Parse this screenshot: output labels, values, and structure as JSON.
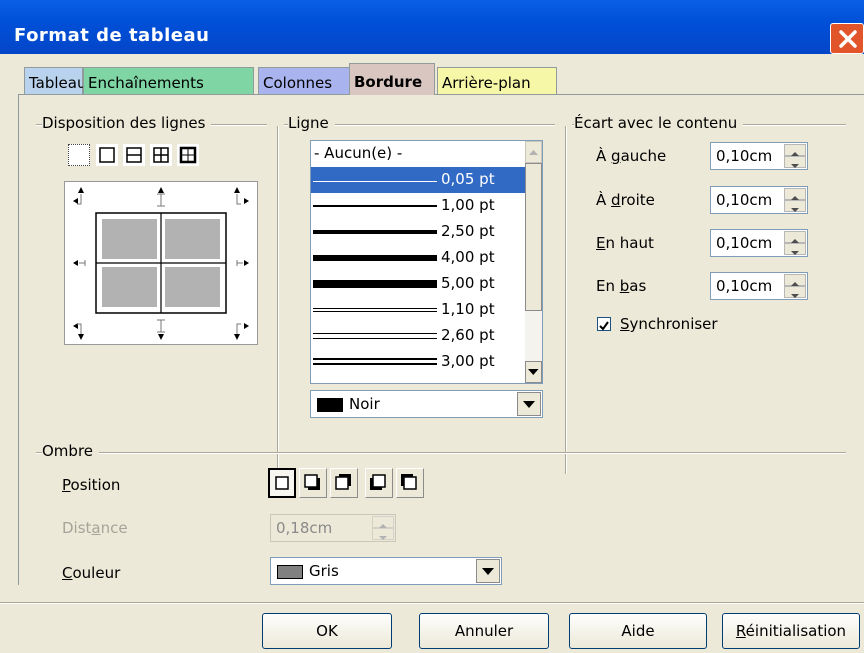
{
  "window": {
    "title": "Format de tableau"
  },
  "tabs": [
    {
      "label": "Tableau",
      "bg": "#b9d3ee",
      "active": false
    },
    {
      "label": "Enchaînements",
      "bg": "#7fd6a4",
      "active": false
    },
    {
      "label": "Colonnes",
      "bg": "#a9b3ee",
      "active": false
    },
    {
      "label": "Bordure",
      "bg": "#d9c6c0",
      "active": true
    },
    {
      "label": "Arrière-plan",
      "bg": "#f7f7a8",
      "active": false
    }
  ],
  "disposition": {
    "title": "Disposition des lignes"
  },
  "ligne": {
    "title": "Ligne",
    "styles": [
      {
        "label": "- Aucun(e) -",
        "selected": false
      },
      {
        "label": "0,05 pt",
        "selected": true
      },
      {
        "label": "1,00 pt",
        "selected": false
      },
      {
        "label": "2,50 pt",
        "selected": false
      },
      {
        "label": "4,00 pt",
        "selected": false
      },
      {
        "label": "5,00 pt",
        "selected": false
      },
      {
        "label": "1,10 pt",
        "selected": false
      },
      {
        "label": "2,60 pt",
        "selected": false
      },
      {
        "label": "3,00 pt",
        "selected": false
      }
    ],
    "color": {
      "label": "Noir",
      "swatch": "#000000"
    }
  },
  "ecart": {
    "title": "Écart avec le contenu",
    "left_label": {
      "pre": "À ",
      "u": "g",
      "post": "auche"
    },
    "right_label": {
      "pre": "À ",
      "u": "d",
      "post": "roite"
    },
    "top_label": {
      "pre": "",
      "u": "E",
      "post": "n haut"
    },
    "bottom_label": {
      "pre": "En ",
      "u": "b",
      "post": "as"
    },
    "left_value": "0,10cm",
    "right_value": "0,10cm",
    "top_value": "0,10cm",
    "bottom_value": "0,10cm",
    "sync": {
      "u": "S",
      "post": "ynchroniser",
      "checked": true
    }
  },
  "ombre": {
    "title": "Ombre",
    "position_label": {
      "u": "P",
      "post": "osition"
    },
    "distance_label": {
      "pre": "Dist",
      "u": "a",
      "post": "nce"
    },
    "distance_value": "0,18cm",
    "couleur_label": {
      "u": "C",
      "post": "ouleur"
    },
    "couleur": {
      "label": "Gris",
      "swatch": "#808080"
    }
  },
  "buttons": {
    "ok": "OK",
    "annuler": "Annuler",
    "aide": "Aide",
    "reset": {
      "u": "R",
      "post": "éinitialisation"
    }
  }
}
